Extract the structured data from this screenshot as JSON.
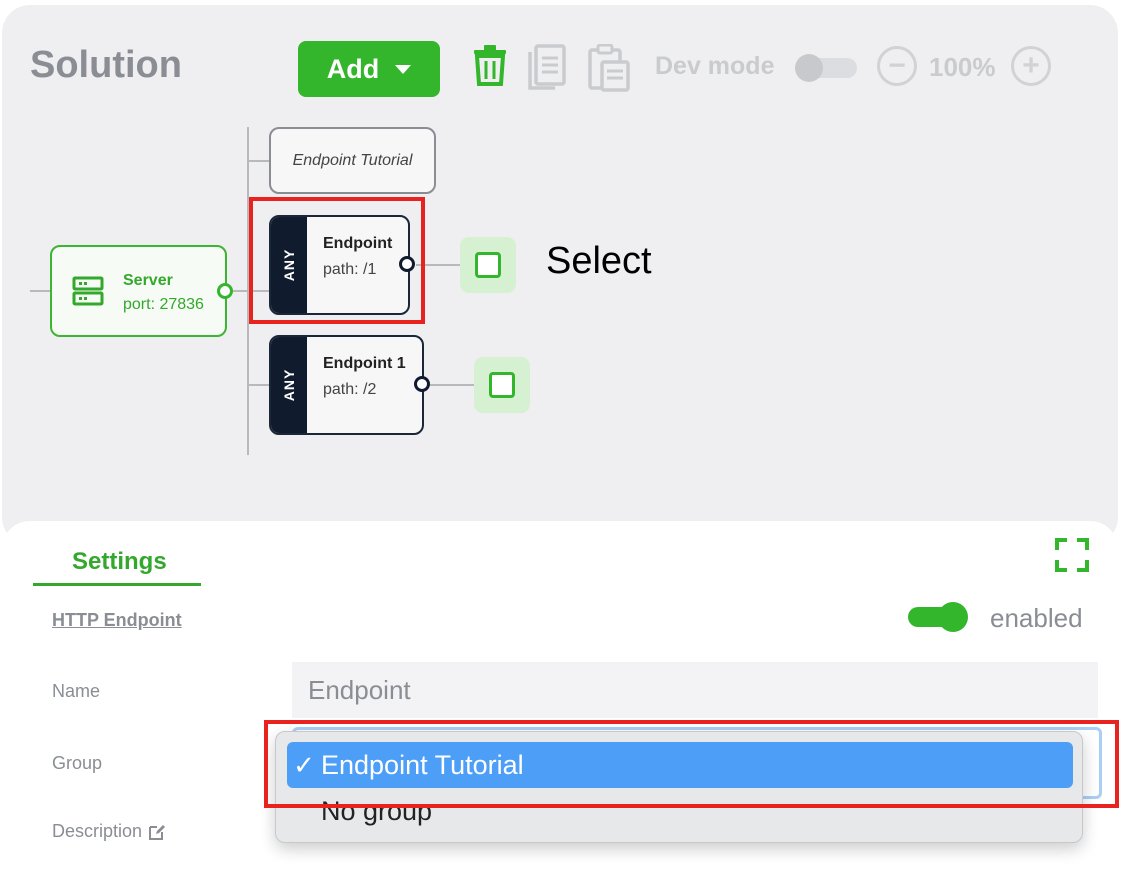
{
  "toolbar": {
    "title": "Solution",
    "add_label": "Add",
    "dev_mode_label": "Dev mode",
    "zoom_minus": "−",
    "zoom_value": "100%",
    "zoom_plus": "+"
  },
  "canvas": {
    "group_node_label": "Endpoint Tutorial",
    "server": {
      "title": "Server",
      "port": "port: 27836"
    },
    "endpoints": [
      {
        "method": "ANY",
        "title": "Endpoint",
        "path": "path: /1"
      },
      {
        "method": "ANY",
        "title": "Endpoint 1",
        "path": "path: /2"
      }
    ],
    "annotation": "Select"
  },
  "settings": {
    "tab_label": "Settings",
    "section_label": "HTTP Endpoint",
    "enabled_label": "enabled",
    "enabled": true,
    "name_label": "Name",
    "name_value": "Endpoint",
    "group_label": "Group",
    "description_label": "Description",
    "group_options": [
      {
        "label": "Endpoint Tutorial",
        "selected": true,
        "check": "✓"
      },
      {
        "label": "No group",
        "selected": false
      }
    ]
  },
  "colors": {
    "accent": "#33b52c",
    "highlight": "#e8221e",
    "menu_selection": "#4d9ef7",
    "node_dark": "#101b2e"
  }
}
